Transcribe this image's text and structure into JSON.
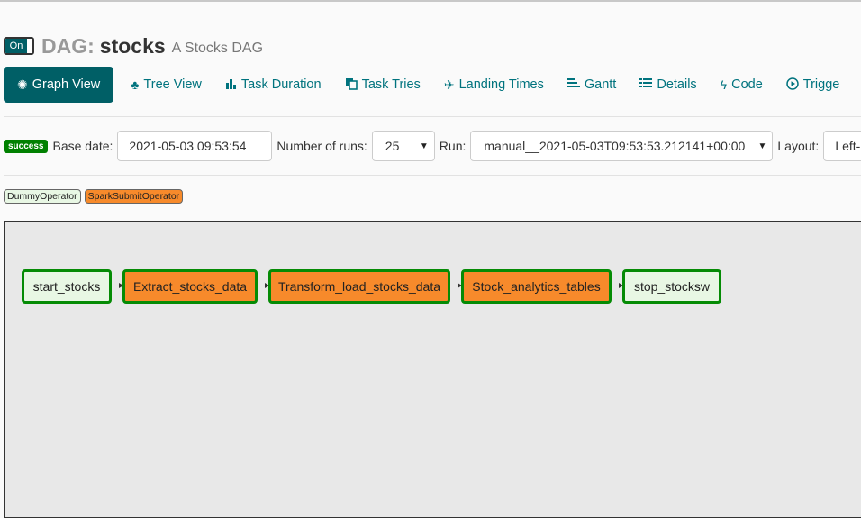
{
  "header": {
    "toggle_label": "On",
    "dag_prefix": "DAG:",
    "dag_id": "stocks",
    "description": "A Stocks DAG"
  },
  "nav": {
    "items": [
      {
        "label": "Graph View",
        "icon": "asterisk-icon"
      },
      {
        "label": "Tree View",
        "icon": "tree-icon"
      },
      {
        "label": "Task Duration",
        "icon": "bar-chart-icon"
      },
      {
        "label": "Task Tries",
        "icon": "duplicate-icon"
      },
      {
        "label": "Landing Times",
        "icon": "plane-icon"
      },
      {
        "label": "Gantt",
        "icon": "gantt-icon"
      },
      {
        "label": "Details",
        "icon": "list-icon"
      },
      {
        "label": "Code",
        "icon": "flash-icon"
      },
      {
        "label": "Trigge",
        "icon": "play-circle-icon"
      }
    ]
  },
  "controls": {
    "status_badge": "success",
    "base_date_label": "Base date:",
    "base_date_value": "2021-05-03 09:53:54",
    "num_runs_label": "Number of runs:",
    "num_runs_value": "25",
    "run_label": "Run:",
    "run_value": "manual__2021-05-03T09:53:53.212141+00:00",
    "layout_label": "Layout:",
    "layout_value": "Left-"
  },
  "legend": {
    "items": [
      {
        "label": "DummyOperator",
        "color": "#e8f7e4"
      },
      {
        "label": "SparkSubmitOperator",
        "color": "#f78a2b"
      }
    ]
  },
  "graph": {
    "nodes": [
      {
        "label": "start_stocks",
        "color": "#e8f7e4",
        "state_color": "#058b05"
      },
      {
        "label": "Extract_stocks_data",
        "color": "#f78a2b",
        "state_color": "#058b05"
      },
      {
        "label": "Transform_load_stocks_data",
        "color": "#f78a2b",
        "state_color": "#058b05"
      },
      {
        "label": "Stock_analytics_tables",
        "color": "#f78a2b",
        "state_color": "#058b05"
      },
      {
        "label": "stop_stocksw",
        "color": "#e8f7e4",
        "state_color": "#058b05"
      }
    ]
  },
  "colors": {
    "accent": "#005f66",
    "link": "#00737e",
    "success": "#008000"
  }
}
